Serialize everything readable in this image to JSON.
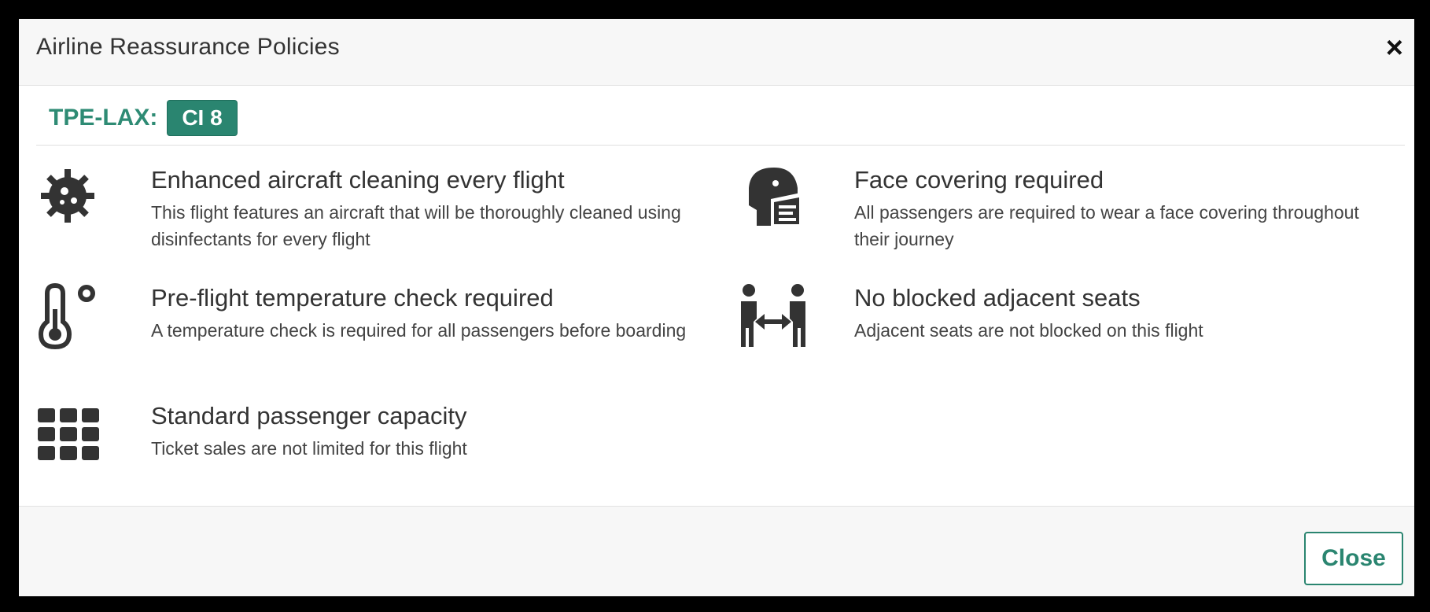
{
  "dialog": {
    "title": "Airline Reassurance Policies",
    "close_x": "×",
    "route_label": "TPE-LAX:",
    "flight_number": "CI 8",
    "close_button": "Close"
  },
  "policies": [
    {
      "icon": "virus-cleaning-icon",
      "title": "Enhanced aircraft cleaning every flight",
      "description": "This flight features an aircraft that will be thoroughly cleaned using disinfectants for every flight"
    },
    {
      "icon": "face-mask-icon",
      "title": "Face covering required",
      "description": "All passengers are required to wear a face covering throughout their journey"
    },
    {
      "icon": "thermometer-icon",
      "title": "Pre-flight temperature check required",
      "description": "A temperature check is required for all passengers before boarding"
    },
    {
      "icon": "social-distance-icon",
      "title": "No blocked adjacent seats",
      "description": "Adjacent seats are not blocked on this flight"
    },
    {
      "icon": "seat-grid-icon",
      "title": "Standard passenger capacity",
      "description": "Ticket sales are not limited for this flight"
    }
  ],
  "colors": {
    "accent": "#2a8570",
    "icon": "#333333"
  }
}
